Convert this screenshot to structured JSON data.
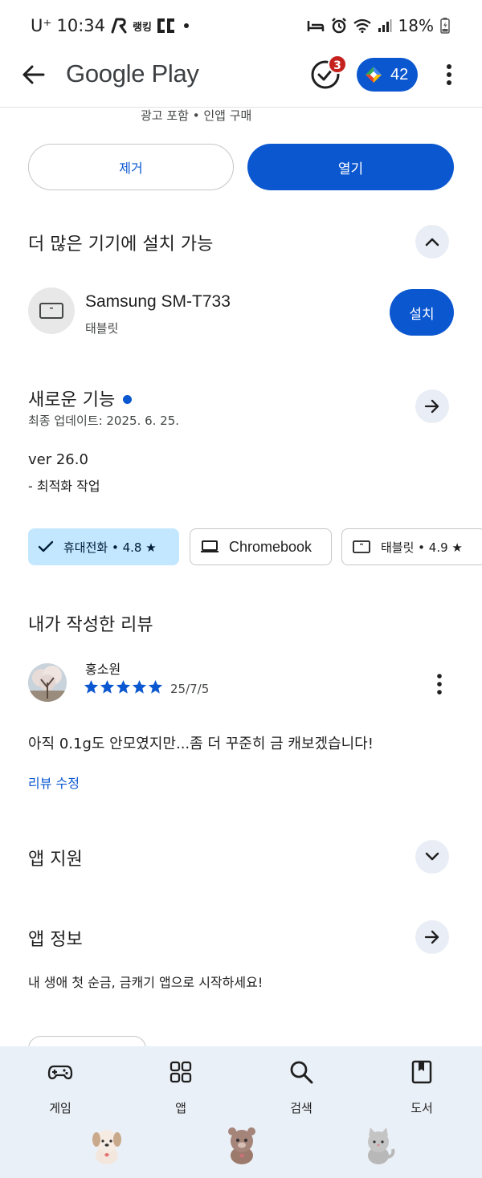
{
  "status_bar": {
    "carrier": "U⁺",
    "time": "10:34",
    "app_label": "랭킹",
    "battery": "18%"
  },
  "app_bar": {
    "title": "Google Play",
    "notification_count": "3",
    "points": "42"
  },
  "app": {
    "ads_note": "광고 포함 • 인앱 구매",
    "uninstall_label": "제거",
    "open_label": "열기"
  },
  "devices": {
    "title": "더 많은 기기에 설치 가능",
    "items": [
      {
        "name": "Samsung SM-T733",
        "type": "태블릿",
        "action": "설치"
      }
    ]
  },
  "whats_new": {
    "title": "새로운 기능",
    "updated": "최종 업데이트: 2025. 6. 25.",
    "version": "ver 26.0",
    "notes": "- 최적화 작업"
  },
  "chips": [
    {
      "label": "휴대전화 • 4.8 ★",
      "selected": true
    },
    {
      "label": "Chromebook",
      "selected": false
    },
    {
      "label": "태블릿 • 4.9 ★",
      "selected": false
    }
  ],
  "my_review": {
    "title": "내가 작성한 리뷰",
    "author": "홍소원",
    "rating": 5,
    "date": "25/7/5",
    "text": "아직 0.1g도 안모였지만...좀 더 꾸준히 금 캐보겠습니다!",
    "edit_label": "리뷰 수정"
  },
  "app_support": {
    "title": "앱 지원"
  },
  "app_info": {
    "title": "앱 정보",
    "description": "내 생애 첫 순금, 금캐기 앱으로 시작하세요!"
  },
  "bottom_nav": [
    {
      "label": "게임",
      "icon": "gamepad-icon"
    },
    {
      "label": "앱",
      "icon": "apps-grid-icon"
    },
    {
      "label": "검색",
      "icon": "search-icon"
    },
    {
      "label": "도서",
      "icon": "book-icon"
    }
  ],
  "colors": {
    "accent": "#0b57d0",
    "chip_selected": "#c2e7ff",
    "nav_bg": "#eaf0f7",
    "badge": "#c5221f"
  }
}
